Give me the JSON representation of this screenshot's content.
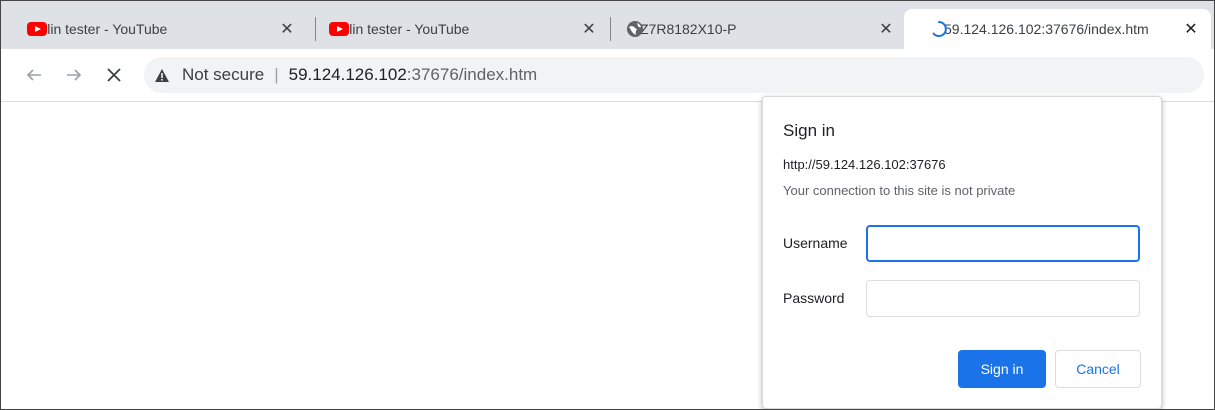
{
  "tabs": [
    {
      "title": "lilin tester - YouTube",
      "icon": "youtube-icon",
      "active": false
    },
    {
      "title": "lilin tester - YouTube",
      "icon": "youtube-icon",
      "active": false
    },
    {
      "title": "Z7R8182X10-P",
      "icon": "globe-icon",
      "active": false
    },
    {
      "title": "59.124.126.102:37676/index.htm",
      "icon": "loading-spinner-icon",
      "active": true
    }
  ],
  "tab_close_glyph": "✕",
  "toolbar": {
    "security_label": "Not secure",
    "separator": "|",
    "url_host": "59.124.126.102",
    "url_path": ":37676/index.htm"
  },
  "dialog": {
    "title": "Sign in",
    "origin": "http://59.124.126.102:37676",
    "warning": "Your connection to this site is not private",
    "username_label": "Username",
    "username_value": "",
    "password_label": "Password",
    "password_value": "",
    "sign_in_label": "Sign in",
    "cancel_label": "Cancel"
  },
  "colors": {
    "tabstrip_bg": "#dee1e6",
    "accent": "#1a73e8",
    "youtube_red": "#ff0000"
  }
}
